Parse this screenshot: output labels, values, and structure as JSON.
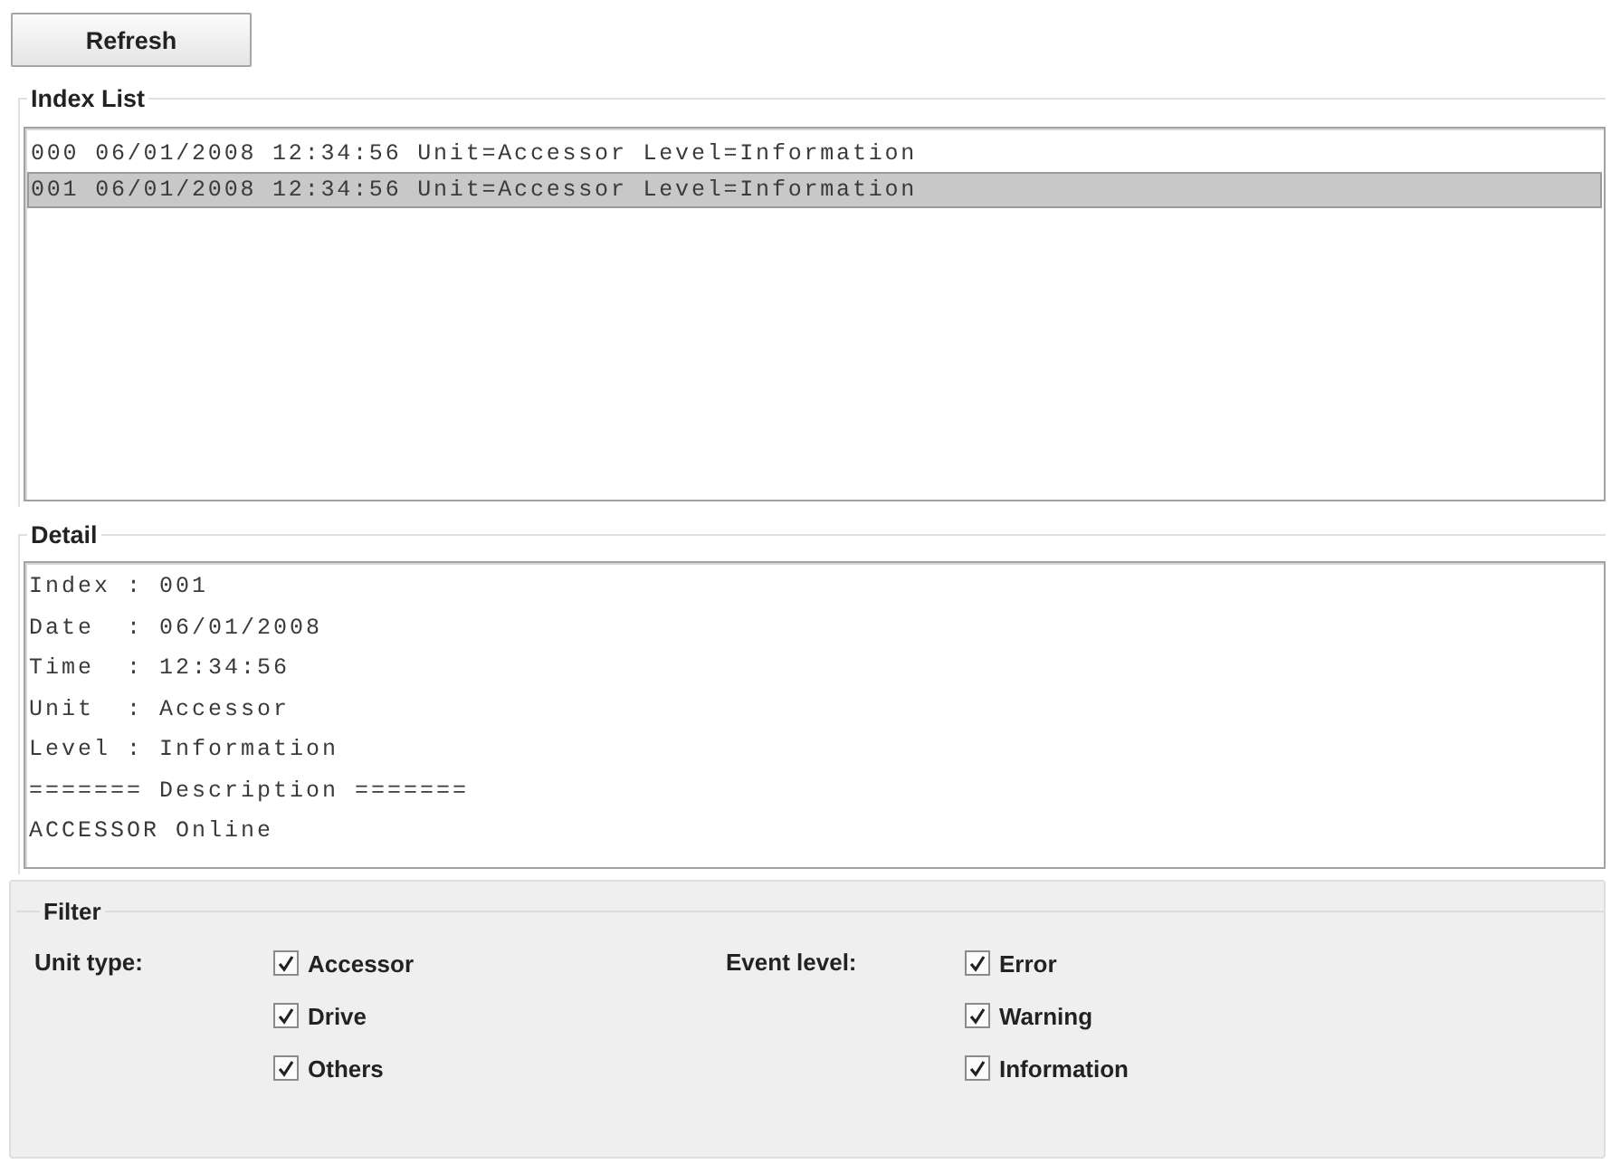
{
  "toolbar": {
    "refresh_button": "Refresh"
  },
  "index_list": {
    "title": "Index List",
    "items": [
      {
        "text": "000 06/01/2008 12:34:56 Unit=Accessor Level=Information",
        "selected": false
      },
      {
        "text": "001 06/01/2008 12:34:56 Unit=Accessor Level=Information",
        "selected": true
      }
    ]
  },
  "detail": {
    "title": "Detail",
    "lines": [
      "Index : 001",
      "Date  : 06/01/2008",
      "Time  : 12:34:56",
      "Unit  : Accessor",
      "Level : Information",
      "======= Description =======",
      "ACCESSOR Online"
    ]
  },
  "filter": {
    "title": "Filter",
    "groups": [
      {
        "label": "Unit type:",
        "options": [
          {
            "label": "Accessor",
            "checked": true
          },
          {
            "label": "Drive",
            "checked": true
          },
          {
            "label": "Others",
            "checked": true
          }
        ]
      },
      {
        "label": "Event level:",
        "options": [
          {
            "label": "Error",
            "checked": true
          },
          {
            "label": "Warning",
            "checked": true
          },
          {
            "label": "Information",
            "checked": true
          }
        ]
      }
    ]
  }
}
